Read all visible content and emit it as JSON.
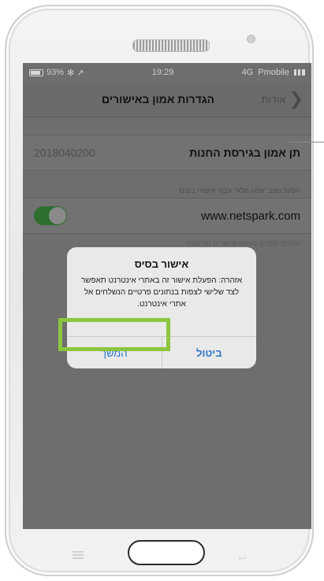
{
  "status_bar": {
    "battery": "93%",
    "icons": "✻ ↗",
    "time": "19:29",
    "network": "4G",
    "carrier": "Pmobile"
  },
  "nav": {
    "title": "הגדרות אמון באישורים",
    "back_label": "אודות",
    "back_icon": "chevron-right-icon"
  },
  "settings": {
    "trust_row": {
      "label": "תן אמון בגירסת החנות",
      "value": "2018040200"
    },
    "section_note": "הפעל מצב \"אמון מלא\" עבור אישורי בסיס",
    "cert_row": {
      "label": "www.netspark.com",
      "enabled": true
    },
    "footer_note": "פרטים נוספים בנושא אישורים מהימנים"
  },
  "alert": {
    "title": "אישור בסיס",
    "message": "אזהרה: הפעלת אישור זה באתרי אינטרנט תאפשר לצד שלישי לצפות בנתונים פרטיים הנשלחים אל אתרי אינטרנט.",
    "continue_label": "המשך",
    "cancel_label": "ביטול"
  },
  "colors": {
    "highlight": "#8cc63f",
    "link": "#2a74c7"
  }
}
